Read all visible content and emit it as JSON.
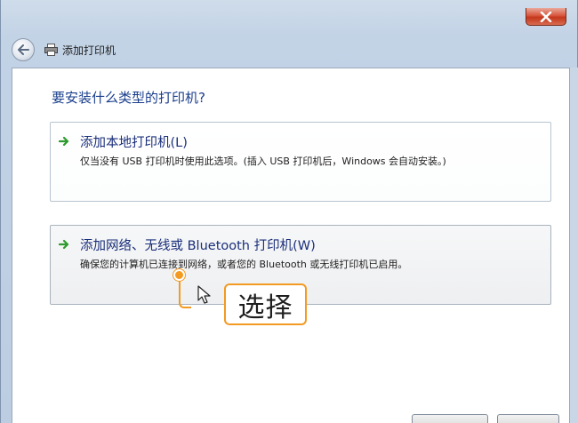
{
  "window": {
    "title": "添加打印机",
    "question": "要安装什么类型的打印机?"
  },
  "options": [
    {
      "title": "添加本地打印机(L)",
      "description": "仅当没有 USB 打印机时使用此选项。(插入 USB 打印机后，Windows 会自动安装。)"
    },
    {
      "title": "添加网络、无线或 Bluetooth 打印机(W)",
      "description": "确保您的计算机已连接到网络，或者您的 Bluetooth 或无线打印机已启用。"
    }
  ],
  "annotation": {
    "label": "选择"
  },
  "colors": {
    "accent": "#f39a22",
    "title_text": "#1a2f7a",
    "question_text": "#1a3e8c",
    "close_button": "#c3371c",
    "option_arrow": "#2e9b2e"
  },
  "icons": {
    "close": "close-icon",
    "back": "back-arrow-icon",
    "printer": "printer-icon",
    "option": "green-arrow-icon",
    "cursor": "mouse-pointer-icon"
  }
}
